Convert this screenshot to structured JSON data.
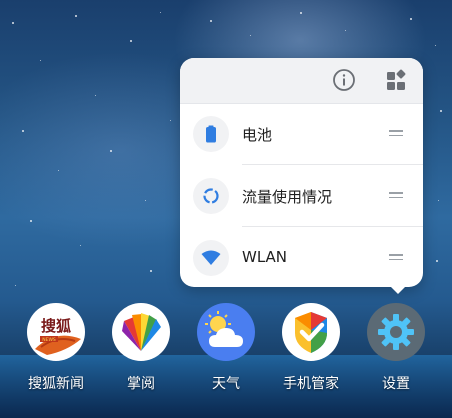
{
  "popup": {
    "items": [
      {
        "label": "电池",
        "icon": "battery-icon"
      },
      {
        "label": "流量使用情况",
        "icon": "data-usage-icon"
      },
      {
        "label": "WLAN",
        "icon": "wifi-icon"
      }
    ],
    "header_icons": [
      "info-icon",
      "widgets-icon"
    ]
  },
  "dock": {
    "apps": [
      {
        "name": "搜狐新闻",
        "icon": "sohu-news-icon",
        "logo_text": "搜狐"
      },
      {
        "name": "掌阅",
        "icon": "ireader-icon"
      },
      {
        "name": "天气",
        "icon": "weather-icon"
      },
      {
        "name": "手机管家",
        "icon": "phone-manager-icon"
      },
      {
        "name": "设置",
        "icon": "settings-icon"
      }
    ]
  },
  "colors": {
    "accent_blue": "#2f7de1",
    "popup_bg": "#ffffff",
    "popup_header_bg": "#f1f2f4"
  }
}
